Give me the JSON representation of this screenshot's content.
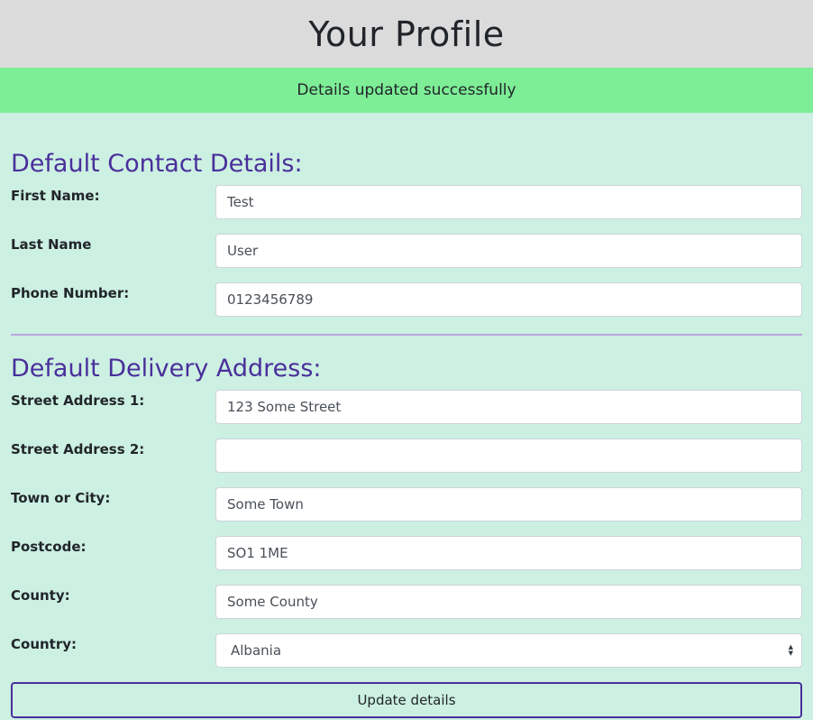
{
  "header": {
    "title": "Your Profile"
  },
  "alert": {
    "message": "Details updated successfully"
  },
  "contact": {
    "heading": "Default Contact Details:",
    "fields": [
      {
        "label": "First Name:",
        "value": "Test"
      },
      {
        "label": "Last Name",
        "value": "User"
      },
      {
        "label": "Phone Number:",
        "value": "0123456789"
      }
    ]
  },
  "delivery": {
    "heading": "Default Delivery Address:",
    "fields": [
      {
        "label": "Street Address 1:",
        "value": "123 Some Street"
      },
      {
        "label": "Street Address 2:",
        "value": ""
      },
      {
        "label": "Town or City:",
        "value": "Some Town"
      },
      {
        "label": "Postcode:",
        "value": "SO1 1ME"
      },
      {
        "label": "County:",
        "value": "Some County"
      }
    ],
    "country": {
      "label": "Country:",
      "selected": "Albania"
    }
  },
  "submit": {
    "label": "Update details"
  },
  "colors": {
    "header_bg": "#dbdbdb",
    "alert_bg": "#7ded96",
    "page_bg": "#ccf0e2",
    "heading_accent": "#4a2f9b"
  }
}
